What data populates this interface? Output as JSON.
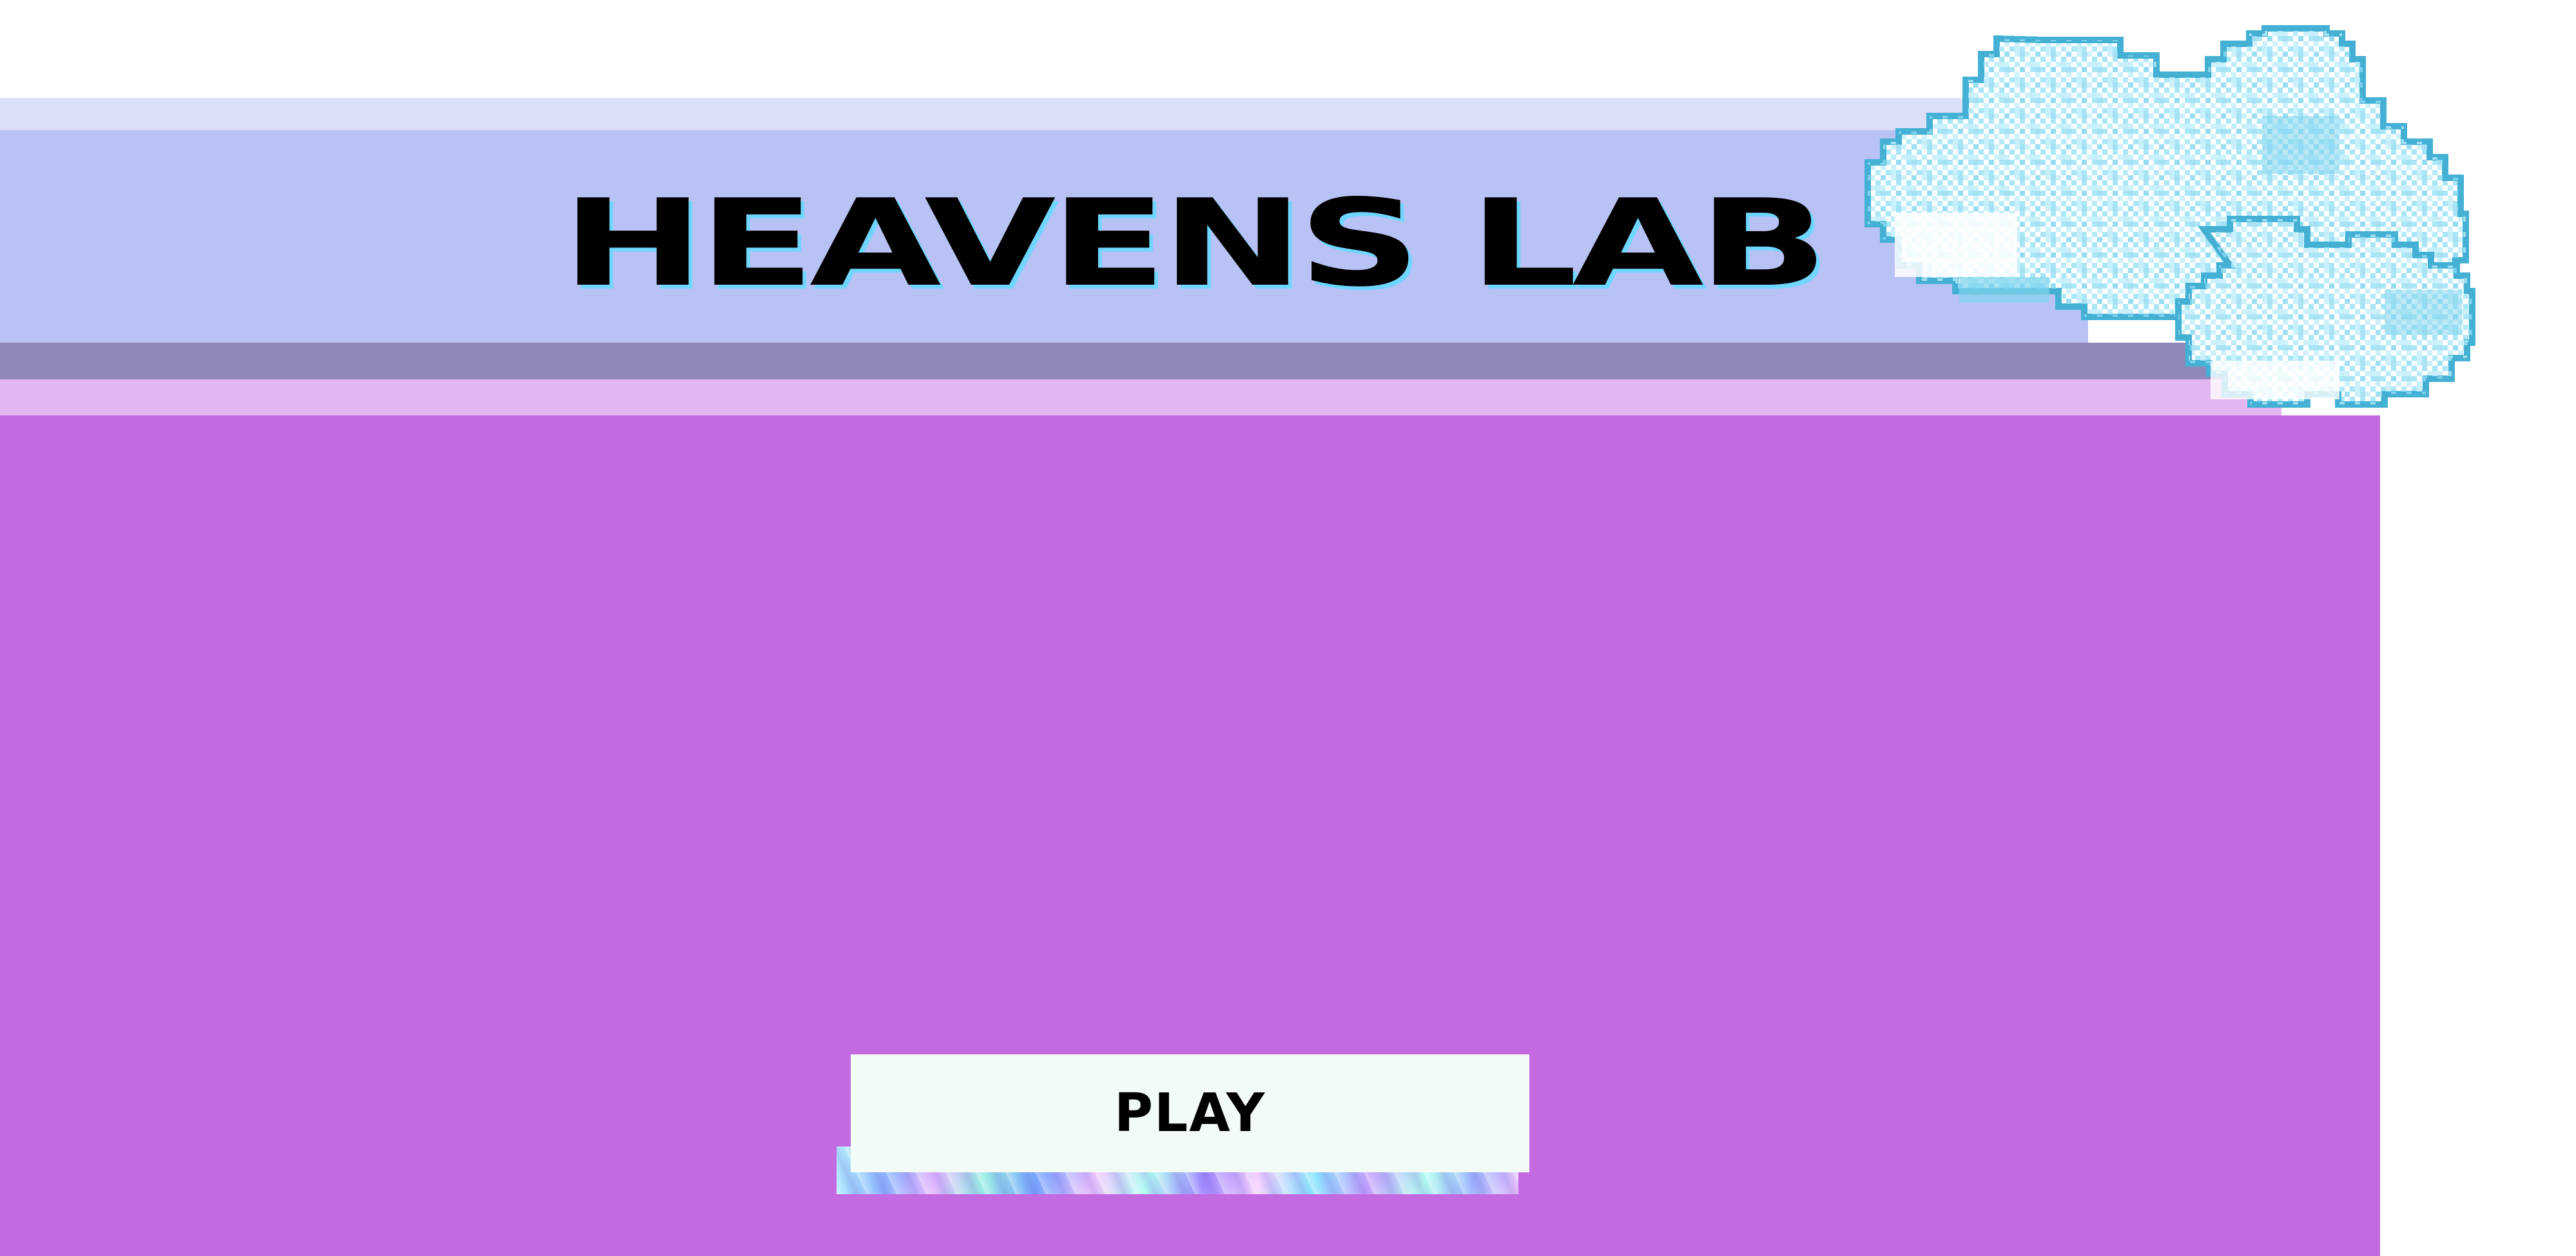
{
  "game": {
    "title": "HEAVENS LAB",
    "play_label": "PLAY"
  },
  "decor": {
    "cloud_icon": "pixel-cloud-icon",
    "holo_strip": "holographic-strip"
  },
  "colors": {
    "background": "#ffffff",
    "band_top_light": "#dbe0f8",
    "band_header": "#b9c2f4",
    "band_shadow": "#8f88bb",
    "band_pink": "#e2b6f0",
    "panel_main": "#c46ae0",
    "title_text": "#000000",
    "button_bg": "#f3fbf6",
    "cloud_outline": "#43b0d4",
    "cloud_fill": "#ffffff",
    "cloud_tint": "#bfeefb"
  }
}
